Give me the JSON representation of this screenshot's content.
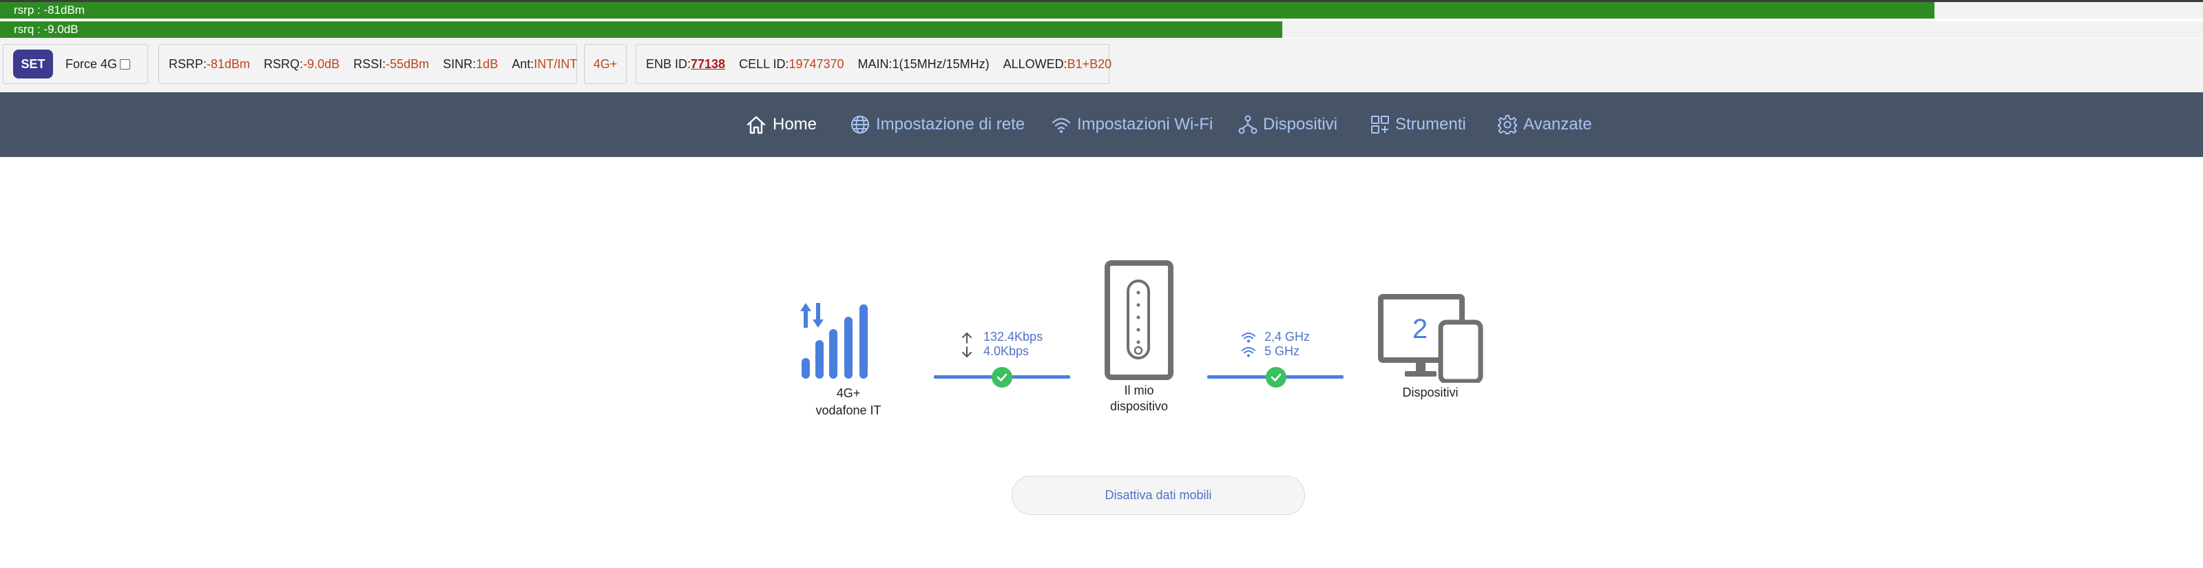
{
  "signal_bars": {
    "rsrp": {
      "label": "rsrp : -81dBm",
      "fill_fraction": 0.878,
      "color": "#2e8b22"
    },
    "rsrq": {
      "label": "rsrq : -9.0dB",
      "fill_fraction": 0.582,
      "color": "#2e8b22"
    }
  },
  "info": {
    "set_label": "SET",
    "force4g_label": "Force 4G",
    "rsrp_label": "RSRP:",
    "rsrp_value": "-81dBm",
    "rsrq_label": "RSRQ:",
    "rsrq_value": "-9.0dB",
    "rssi_label": "RSSI:",
    "rssi_value": "-55dBm",
    "sinr_label": "SINR:",
    "sinr_value": "1dB",
    "ant_label": "Ant:",
    "ant_value": "INT/INT",
    "network_type": "4G+",
    "enb_label": "ENB ID:",
    "enb_value": "77138",
    "cell_label": "CELL ID:",
    "cell_value": "19747370",
    "main_label": "MAIN:1(15MHz/15MHz)",
    "allowed_label": "ALLOWED:",
    "allowed_value": "B1+B20"
  },
  "nav": {
    "home": "Home",
    "network": "Impostazione di rete",
    "wifi": "Impostazioni Wi-Fi",
    "devices": "Dispositivi",
    "tools": "Strumenti",
    "advanced": "Avanzate"
  },
  "main": {
    "network_type": "4G+",
    "operator": "vodafone IT",
    "upload_speed": "132.4Kbps",
    "download_speed": "4.0Kbps",
    "router_label_line1": "Il mio",
    "router_label_line2": "dispositivo",
    "wifi_band1": "2,4 GHz",
    "wifi_band2": "5 GHz",
    "devices_count": "2",
    "devices_label": "Dispositivi",
    "mobile_data_button": "Disattiva dati mobili"
  },
  "colors": {
    "accent_blue": "#4a7fe0",
    "nav_bg": "#475467",
    "signal_green": "#2e8b22",
    "value_orange": "#c0441b",
    "check_green": "#3cc061"
  }
}
